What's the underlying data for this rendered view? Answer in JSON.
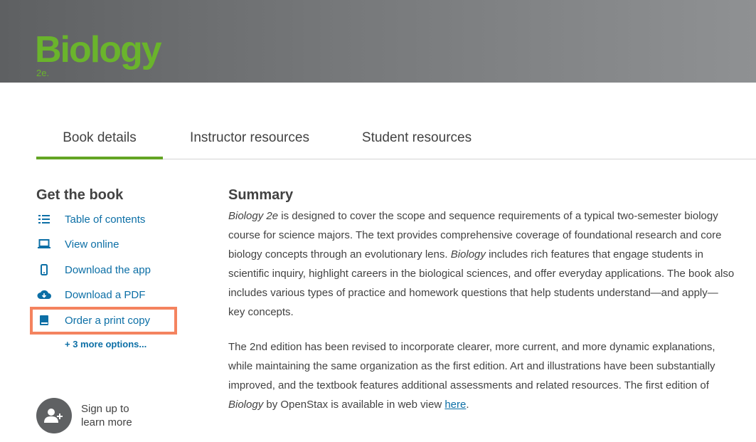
{
  "hero": {
    "title": "Biology",
    "edition": "2e."
  },
  "tabs": [
    {
      "label": "Book details",
      "active": true
    },
    {
      "label": "Instructor resources",
      "active": false
    },
    {
      "label": "Student resources",
      "active": false
    }
  ],
  "sidebar": {
    "heading": "Get the book",
    "options": [
      {
        "label": "Table of contents",
        "icon": "list-icon"
      },
      {
        "label": "View online",
        "icon": "laptop-icon"
      },
      {
        "label": "Download the app",
        "icon": "phone-icon"
      },
      {
        "label": "Download a PDF",
        "icon": "cloud-download-icon"
      },
      {
        "label": "Order a print copy",
        "icon": "book-icon"
      }
    ],
    "more_options": "+ 3 more options...",
    "signup_line1": "Sign up to",
    "signup_line2": "learn more"
  },
  "summary": {
    "heading": "Summary",
    "p1_book": "Biology 2e",
    "p1_a": " is designed to cover the scope and sequence requirements of a typical two-semester biology course for science majors. The text provides comprehensive coverage of foundational research and core biology concepts through an evolutionary lens. ",
    "p1_book2": "Biology",
    "p1_b": " includes rich features that engage students in scientific inquiry, highlight careers in the biological sciences, and offer everyday applications. The book also includes various types of practice and homework questions that help students understand—and apply—key concepts.",
    "p2_a": "The 2nd edition has been revised to incorporate clearer, more current, and more dynamic explanations, while maintaining the same organization as the first edition. Art and illustrations have been substantially improved, and the textbook features additional assessments and related resources. The first edition of ",
    "p2_book": "Biology",
    "p2_b": " by OpenStax is available in web view ",
    "p2_link": "here",
    "p2_end": "."
  },
  "colors": {
    "accent_green": "#6ab42c",
    "tab_underline": "#63a524",
    "link_blue": "#0c6fa6",
    "highlight_orange": "#f4835f"
  }
}
